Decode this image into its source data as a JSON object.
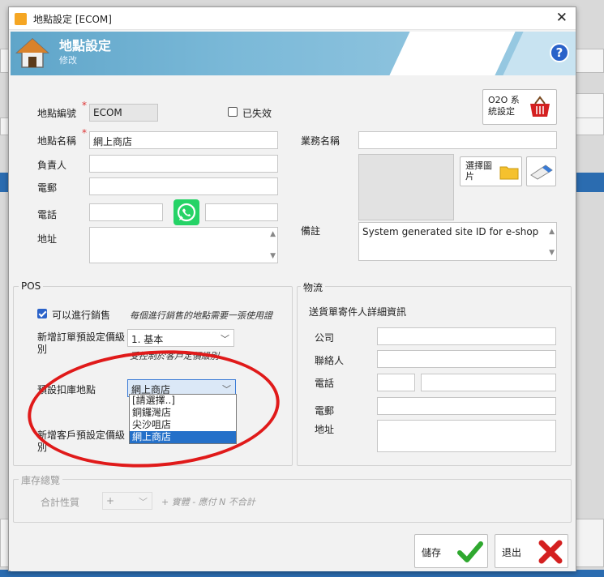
{
  "window": {
    "title": "地點設定 [ECOM]",
    "close_glyph": "✕"
  },
  "banner": {
    "title": "地點設定",
    "subtitle": "修改",
    "help_glyph": "?"
  },
  "form": {
    "code_label": "地點編號",
    "code_value": "ECOM",
    "lost_label": "已失效",
    "o2o_label": "O2O 系統設定",
    "name_label": "地點名稱",
    "name_value": "網上商店",
    "business_name_label": "業務名稱",
    "manager_label": "負責人",
    "email_label": "電郵",
    "phone_label": "電話",
    "address_label": "地址",
    "select_image_label": "選擇圖片",
    "remark_label": "備註",
    "remark_value": "System generated site ID for e-shop"
  },
  "pos": {
    "title": "POS",
    "can_sell_label": "可以進行銷售",
    "can_sell_note": "每個進行銷售的地點需要一張使用證",
    "order_price_label": "新增訂單預設定價級別",
    "order_price_value": "1. 基本",
    "order_price_note": "受控制於客戶定價級別",
    "default_stock_label": "預設扣庫地點",
    "default_stock_value": "網上商店",
    "customer_price_label": "新增客戶預設定價級別",
    "dropdown_options": [
      "[請選擇..]",
      "銅鑼灣店",
      "尖沙咀店",
      "網上商店"
    ],
    "dropdown_selected_index": 3
  },
  "logistics": {
    "title": "物流",
    "sender_label": "送貨單寄件人詳細資訊",
    "company_label": "公司",
    "contact_label": "聯絡人",
    "phone_label": "電話",
    "email_label": "電郵",
    "address_label": "地址"
  },
  "stock": {
    "title": "庫存總覽",
    "total_label": "合計性質",
    "total_value": "+",
    "total_note": "+ 實體 - 應付 N 不合計"
  },
  "buttons": {
    "save": "儲存",
    "exit": "退出"
  },
  "colors": {
    "accent": "#2a62c9",
    "highlight": "#2470c9",
    "annotation": "#e01a1a",
    "whatsapp": "#25d366"
  }
}
